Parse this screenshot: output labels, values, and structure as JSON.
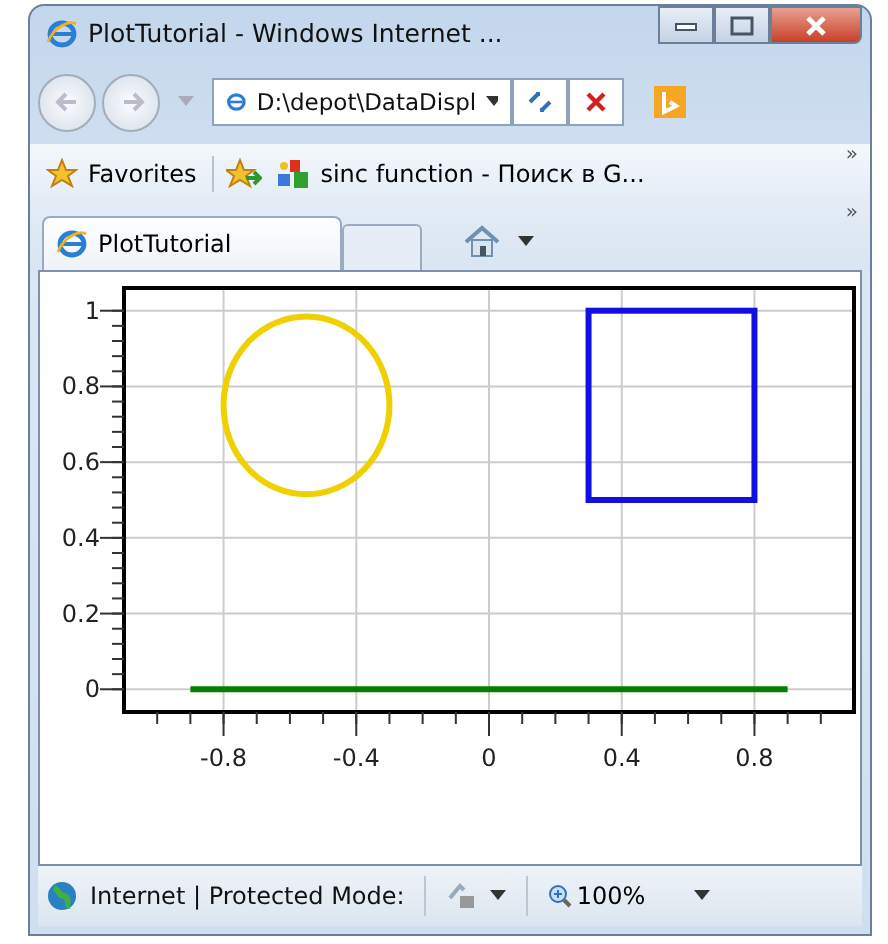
{
  "window": {
    "title": "PlotTutorial - Windows Internet ..."
  },
  "address_bar": {
    "value": "D:\\depot\\DataDispl"
  },
  "favorites_bar": {
    "favorites": "Favorites",
    "links": [
      "sinc function - Поиск в G..."
    ],
    "overflow": "»"
  },
  "tabs": [
    {
      "label": "PlotTutorial",
      "selected": true
    }
  ],
  "command_bar": {
    "overflow": "»"
  },
  "plot": {
    "chart_data": {
      "type": "line",
      "xlim": [
        -1.1,
        1.1
      ],
      "ylim": [
        -0.06,
        1.06
      ],
      "xticks": [
        {
          "value": -0.8,
          "label": "-0.8"
        },
        {
          "value": -0.4,
          "label": "-0.4"
        },
        {
          "value": 0,
          "label": "0"
        },
        {
          "value": 0.4,
          "label": "0.4"
        },
        {
          "value": 0.8,
          "label": "0.8"
        }
      ],
      "yticks": [
        {
          "value": 0,
          "label": "0"
        },
        {
          "value": 0.2,
          "label": "0.2"
        },
        {
          "value": 0.4,
          "label": "0.4"
        },
        {
          "value": 0.6,
          "label": "0.6"
        },
        {
          "value": 0.8,
          "label": "0.8"
        },
        {
          "value": 1,
          "label": "1"
        }
      ],
      "series": [
        {
          "color": "#008000",
          "values": [
            0,
            0
          ]
        }
      ],
      "x": [
        -0.9,
        0.9
      ],
      "grid": true
    },
    "shapes": [
      {
        "kind": "ellipse",
        "color": "#f0d000"
      },
      {
        "kind": "rectangle",
        "color": "#1010e0"
      }
    ]
  },
  "status_bar": {
    "zone": "Internet | Protected Mode:",
    "zoom": "100%"
  }
}
